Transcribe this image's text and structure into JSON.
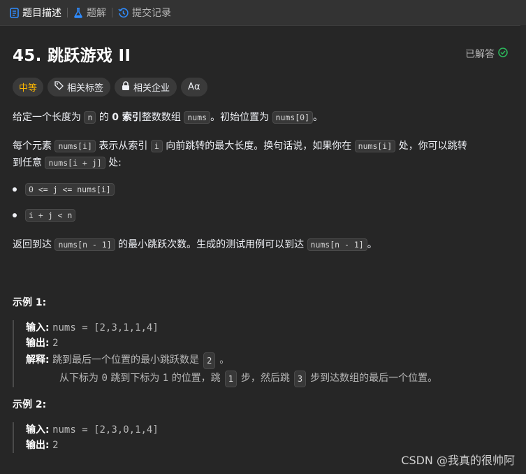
{
  "tabs": [
    {
      "label": "题目描述",
      "icon": "document-icon",
      "color": "#2f8cff"
    },
    {
      "label": "题解",
      "icon": "flask-icon",
      "color": "#2f8cff"
    },
    {
      "label": "提交记录",
      "icon": "history-icon",
      "color": "#2f8cff"
    }
  ],
  "problem": {
    "title": "45. 跳跃游戏 II",
    "status": "已解答",
    "status_color": "#2cbb5d"
  },
  "tags": {
    "difficulty": "中等",
    "difficulty_color": "#ffb800",
    "related_tags": "相关标签",
    "related_companies": "相关企业",
    "font_button": "Aα"
  },
  "description": {
    "p1": {
      "t1": "给定一个长度为 ",
      "c1": "n",
      "t2": " 的 ",
      "b1": "0 索引",
      "t3": "整数数组 ",
      "c2": "nums",
      "t4": "。初始位置为 ",
      "c3": "nums[0]",
      "t5": "。"
    },
    "p2": {
      "t1": "每个元素 ",
      "c1": "nums[i]",
      "t2": " 表示从索引 ",
      "c2": "i",
      "t3": " 向前跳转的最大长度。换句话说，如果你在 ",
      "c3": "nums[i]",
      "t4": " 处，你可以跳转",
      "t5": "到任意 ",
      "c4": "nums[i + j]",
      "t6": " 处:"
    },
    "bullets": [
      "0 <= j <= nums[i]",
      "i + j < n"
    ],
    "p3": {
      "t1": "返回到达 ",
      "c1": "nums[n - 1]",
      "t2": " 的最小跳跃次数。生成的测试用例可以到达 ",
      "c2": "nums[n - 1]",
      "t3": "。"
    }
  },
  "examples": [
    {
      "heading": "示例 1:",
      "input_label": "输入:",
      "input": "nums = [2,3,1,1,4]",
      "output_label": "输出:",
      "output": "2",
      "explain_label": "解释:",
      "explain1_a": "跳到最后一个位置的最小跳跃数是",
      "explain1_c": "2",
      "explain1_b": "。",
      "explain2_a": "从下标为",
      "explain2_v1": "0",
      "explain2_b": "跳到下标为",
      "explain2_v2": "1",
      "explain2_c": "的位置，跳",
      "explain2_c1": "1",
      "explain2_d": "步，然后跳",
      "explain2_c2": "3",
      "explain2_e": "步到达数组的最后一个位置。"
    },
    {
      "heading": "示例 2:",
      "input_label": "输入:",
      "input": "nums = [2,3,0,1,4]",
      "output_label": "输出:",
      "output": "2"
    }
  ],
  "watermark": "CSDN @我真的很帅阿"
}
